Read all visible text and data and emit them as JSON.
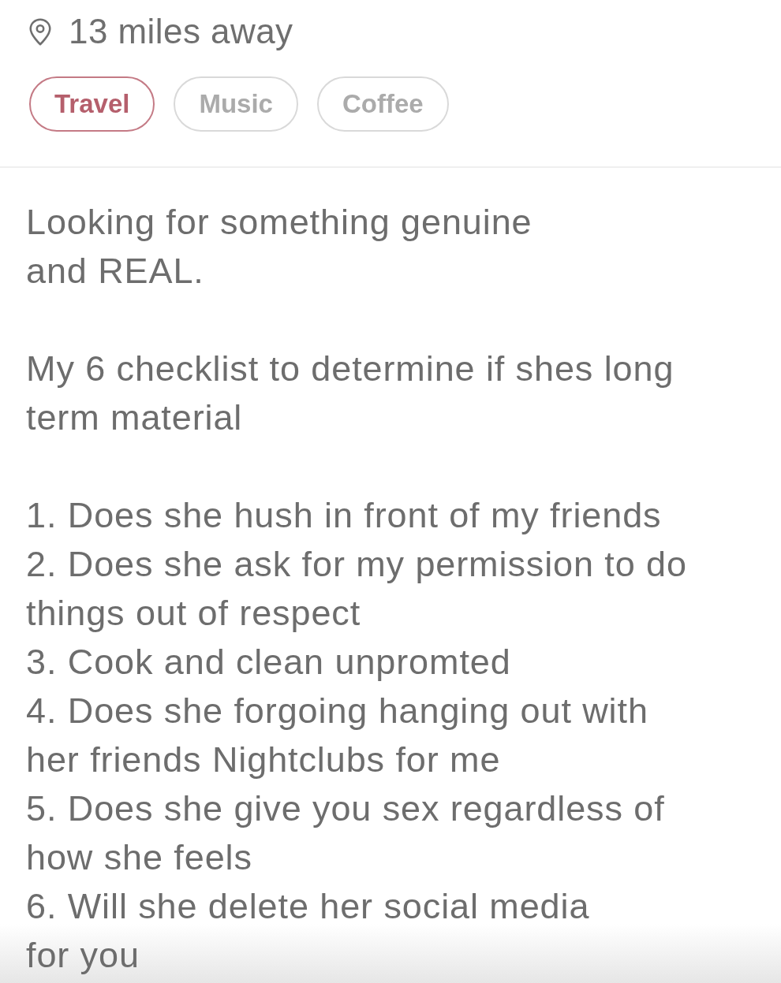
{
  "location": {
    "text": "13 miles away"
  },
  "interests": [
    {
      "label": "Travel",
      "highlighted": true
    },
    {
      "label": "Music",
      "highlighted": false
    },
    {
      "label": "Coffee",
      "highlighted": false
    }
  ],
  "bio": {
    "paragraphs": [
      "Looking for something genuine\nand REAL.",
      "My 6 checklist to determine if shes long\nterm material"
    ],
    "checklist": [
      "1. Does she hush in front of my friends",
      "2. Does she ask for my permission to do\nthings out of respect",
      "3. Cook and clean unpromted",
      "4. Does she forgoing hanging out with\nher friends Nightclubs for me",
      "5. Does she give you sex regardless of\nhow she feels",
      "6. Will she delete her social media\nfor you"
    ]
  }
}
